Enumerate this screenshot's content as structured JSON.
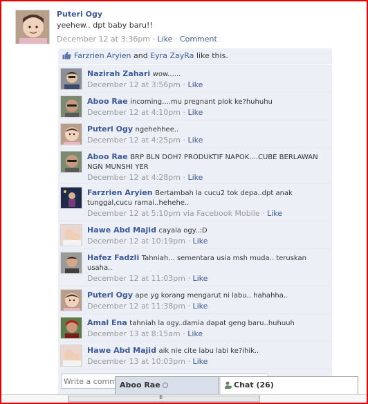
{
  "post": {
    "author": "Puteri Ogy",
    "text": "yeehew.. dpt baby baru!!",
    "time": "December 12 at 3:36pm",
    "separator": "·",
    "like_label": "Like",
    "comment_label": "Comment"
  },
  "likes": {
    "person1": "Farzrien Aryien",
    "and": "and",
    "person2": "Eyra ZayRa",
    "suffix": "like this."
  },
  "comments": [
    {
      "name": "Nazirah Zahari",
      "text": "wow......",
      "time": "December 12 at 3:56pm",
      "via": "",
      "like": "Like"
    },
    {
      "name": "Aboo Rae",
      "text": "incoming....mu pregnant plok ke?huhuhu",
      "time": "December 12 at 4:10pm",
      "via": "",
      "like": "Like"
    },
    {
      "name": "Puteri Ogy",
      "text": "ngehehhee..",
      "time": "December 12 at 4:25pm",
      "via": "",
      "like": "Like"
    },
    {
      "name": "Aboo Rae",
      "text": "BRP BLN DOH? PRODUKTIF NAPOK....CUBE BERLAWAN NGN MUNSHI YER",
      "time": "December 12 at 4:28pm",
      "via": "",
      "like": "Like"
    },
    {
      "name": "Farzrien Aryien",
      "text": "Bertambah la cucu2 tok depa..dpt anak tunggal,cucu ramai..hehehe..",
      "time": "December 12 at 5:10pm",
      "via": "via Facebook Mobile",
      "like": "Like"
    },
    {
      "name": "Hawe Abd Majid",
      "text": "cayala ogy..:D",
      "time": "December 12 at 10:19pm",
      "via": "",
      "like": "Like"
    },
    {
      "name": "Hafez Fadzli",
      "text": "Tahniah... sementara usia msh muda.. teruskan usaha..",
      "time": "December 12 at 11:03pm",
      "via": "",
      "like": "Like"
    },
    {
      "name": "Puteri Ogy",
      "text": "ape yg korang mengarut ni labu.. hahahha..",
      "time": "December 12 at 11:38pm",
      "via": "",
      "like": "Like"
    },
    {
      "name": "Amal Ena",
      "text": "tahniah la ogy..damia dapat geng baru..huhuuh",
      "time": "December 13 at 8:15am",
      "via": "",
      "like": "Like"
    },
    {
      "name": "Hawe Abd Majid",
      "text": "aik nie cite labu labi ke?ihik..",
      "time": "December 13 at 10:03pm",
      "via": "",
      "like": "Like"
    }
  ],
  "write_comment_placeholder": "Write a comment...",
  "chat": {
    "open_tab": "Aboo Rae",
    "chat_label": "Chat",
    "online_count": "(26)"
  },
  "scroll_grip": "III",
  "colors": {
    "link": "#3b5998",
    "frame_border": "#e60000",
    "comment_bg": "#eceff5"
  },
  "icons": {
    "like": "thumbs-up-icon",
    "status": "status-ring-icon",
    "chat": "online-person-icon"
  }
}
